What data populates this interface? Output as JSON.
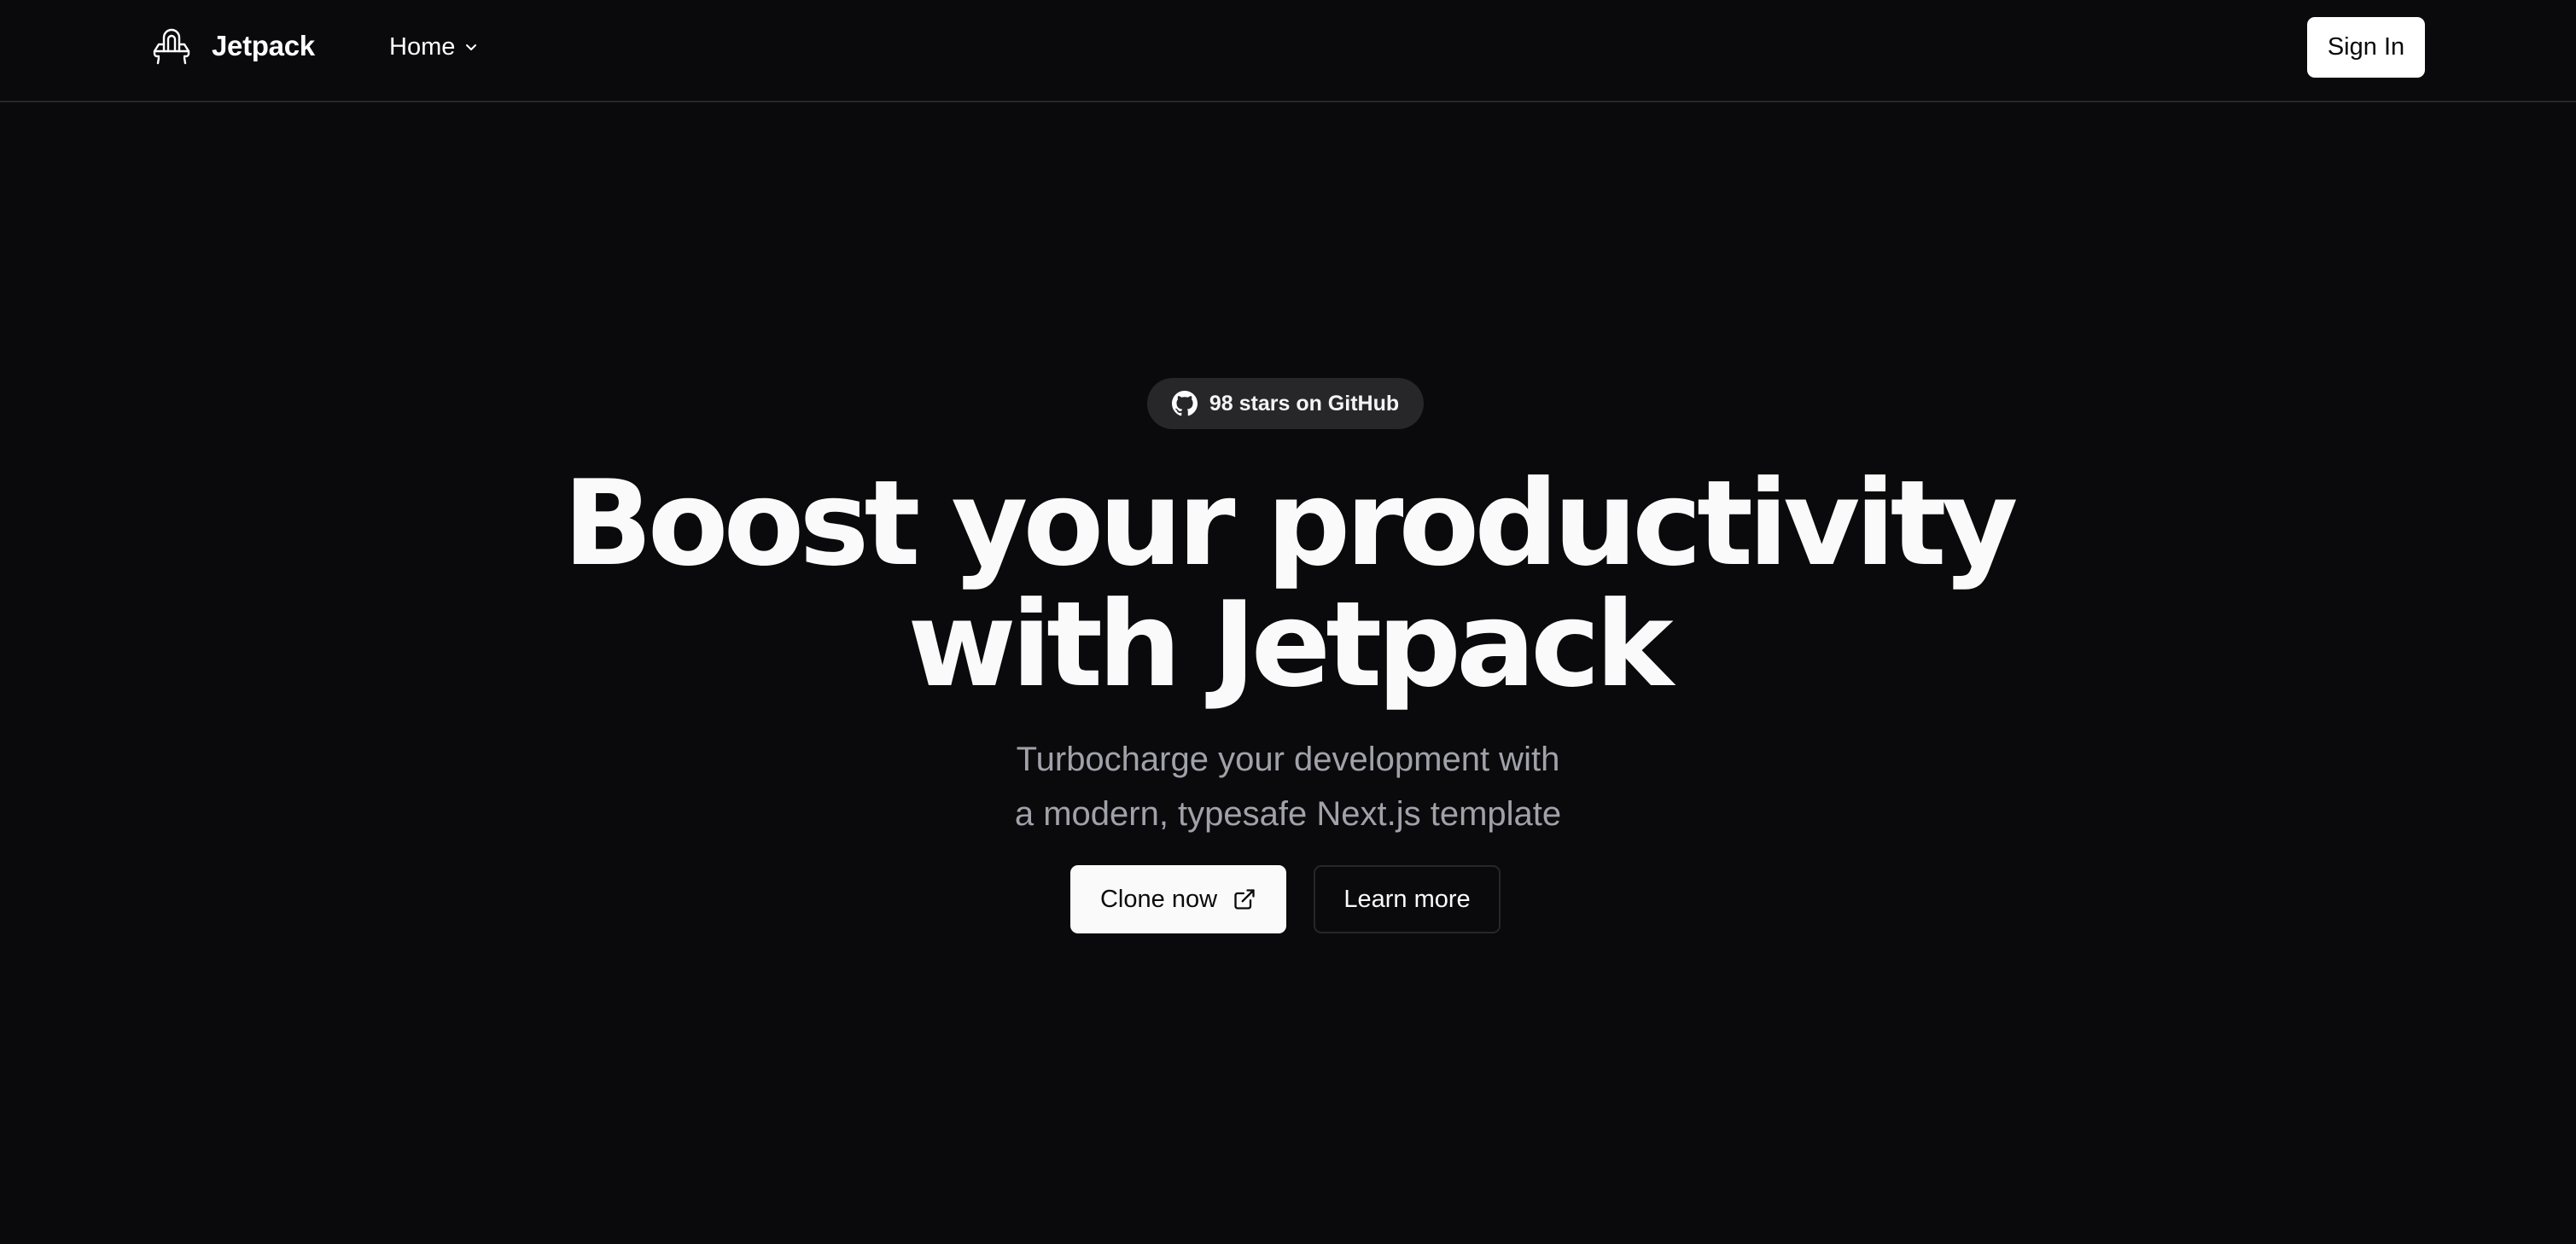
{
  "header": {
    "brand": "Jetpack",
    "brand_icon": "jetpack-logo-icon",
    "nav": {
      "home_label": "Home",
      "home_icon": "chevron-down-icon"
    },
    "sign_in_label": "Sign In"
  },
  "hero": {
    "badge": {
      "icon": "github-icon",
      "label": "98 stars on GitHub"
    },
    "headline_line1": "Boost your productivity",
    "headline_line2": "with Jetpack",
    "subtitle_line1": "Turbocharge your development with",
    "subtitle_line2": "a modern, typesafe Next.js template",
    "primary_cta": {
      "label": "Clone now",
      "icon": "external-link-icon"
    },
    "secondary_cta": {
      "label": "Learn more"
    }
  },
  "colors": {
    "background": "#0a0a0c",
    "foreground": "#fafafa",
    "muted_text": "#a1a1aa",
    "badge_bg": "#27272a",
    "border": "#26262b"
  }
}
